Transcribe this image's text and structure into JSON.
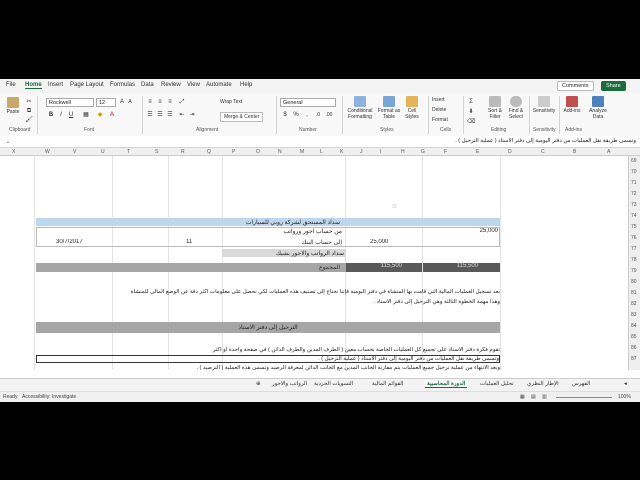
{
  "menu": {
    "tabs": [
      "File",
      "Home",
      "Insert",
      "Page Layout",
      "Formulas",
      "Data",
      "Review",
      "View",
      "Automate",
      "Help"
    ],
    "active": "Home",
    "comments_label": "Comments",
    "share_label": "Share"
  },
  "ribbon": {
    "paste": "Paste",
    "font_name": "Rockwell",
    "font_size": "12",
    "wrap_text": "Wrap Text",
    "merge_center": "Merge & Center",
    "number_format": "General",
    "conditional_formatting": "Conditional Formatting",
    "format_as_table": "Format as Table",
    "cell_styles": "Cell Styles",
    "insert": "Insert",
    "delete": "Delete",
    "format": "Format",
    "sort_filter": "Sort & Filter",
    "find_select": "Find & Select",
    "sensitivity": "Sensitivity",
    "add_ins": "Add-ins",
    "analyze_data": "Analyze Data",
    "groups": [
      "Clipboard",
      "Font",
      "Alignment",
      "Number",
      "Styles",
      "Cells",
      "Editing",
      "Sensitivity",
      "Add-ins"
    ]
  },
  "formula_bar": {
    "content": "وتسمى طريقة نقل العمليات من دفتر اليومية إلى دفتر الاستاذ ( عملية الترحيل ) ."
  },
  "columns": [
    "X",
    "W",
    "V",
    "U",
    "T",
    "S",
    "R",
    "Q",
    "P",
    "O",
    "N",
    "M",
    "L",
    "K",
    "J",
    "I",
    "H",
    "G",
    "F",
    "E",
    "D",
    "C",
    "B",
    "A"
  ],
  "rows": [
    "69",
    "70",
    "71",
    "72",
    "73",
    "74",
    "75",
    "76",
    "77",
    "78",
    "79",
    "80",
    "81",
    "82",
    "83",
    "84",
    "85",
    "86",
    "87"
  ],
  "sheet": {
    "row74_text": "سداد المستحق لشركة روبي للسيارات",
    "row75_debit_label": "من حساب اجور ورواتب",
    "row75_amount": "25,000",
    "row76_credit_label": "إلى حساب البنك",
    "row76_amount": "25,000",
    "row76_date": "30/7/2017",
    "row76_ref": "11",
    "row77_text": "سداد الرواتب والاجور بشيك",
    "total_label": "المجموع",
    "total_debit": "115,500",
    "total_credit": "115,500",
    "para1_line1": "بعد تسجيل العمليات المالية التي قامت بها المنشأة في دفتر اليومية فإننا نحتاج إلى تصنيف هذه العمليات لكي نحصل على معلومات اكثر دقة عن الوضع المالي للمنشأة",
    "para1_line2": "وهذا مهمة الخطوة الثالثة وهي الترحيل إلى دفتر الاستاذ .",
    "section_title": "الترحيل إلى دفتر الاستاذ",
    "para2_line1": "تقوم فكرة دفتر الاستاذ على تجميع كل العمليات الخاصة بحساب معين ( الطرف المدين والطرف الدائن ) في صفحة واحدة او اكثر",
    "para2_line2": "وتسمى طريقة نقل العمليات من دفتر اليومية إلى دفتر الاستاذ ( عملية الترحيل ) .",
    "para2_line3": "وبعد الانتهاء من عملية ترحيل جميع العمليات يتم مقارنة الجانب المدين مع الجانب الدائن لمعرفة الرصيد وتسمى هذة العملية ( الترصيد ) ."
  },
  "sheet_tabs": [
    "الفهرس",
    "الإطار النظري",
    "تحليل العمليات",
    "الدورة المحاسبية",
    "القوائم المالية",
    "التسويات الجردية",
    "الرواتب والاجور"
  ],
  "active_sheet": "الدورة المحاسبية",
  "status": {
    "ready": "Ready",
    "accessibility": "Accessibility: Investigate",
    "zoom": "100%"
  },
  "colors": {
    "accent": "#1d6b3a",
    "header_blue": "#bdd7ee",
    "total_dark": "#595959"
  }
}
